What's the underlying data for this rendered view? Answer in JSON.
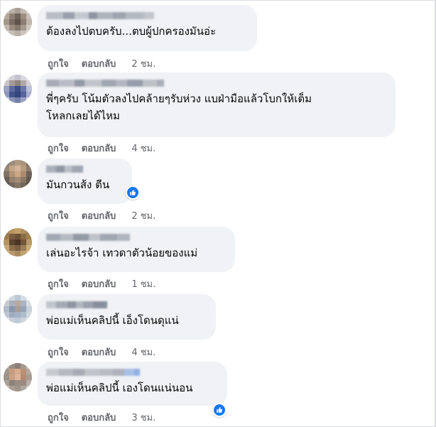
{
  "colors": {
    "bubble_bg": "#f0f2f5",
    "action_text": "#65676b",
    "like_blue": "#1877f2"
  },
  "comments": [
    {
      "text_lines": [
        "ต้องลงไปตบครับ...ตบผู้ปกครองมันอ่ะ"
      ],
      "like_label": "ถูกใจ",
      "reply_label": "ตอบกลับ",
      "time": "2 ชม.",
      "has_like_reaction": false
    },
    {
      "text_lines": [
        "พี่ๆครับ โน้มตัวลงไปคล้ายๆรับห่วง แบฝ่ามือแล้วโบกให้เต็ม",
        "โหลกเลยได้ไหม"
      ],
      "like_label": "ถูกใจ",
      "reply_label": "ตอบกลับ",
      "time": "4 ชม.",
      "has_like_reaction": false
    },
    {
      "text_lines": [
        "มันกวนส้ง ตีน"
      ],
      "like_label": "ถูกใจ",
      "reply_label": "ตอบกลับ",
      "time": "2 ชม.",
      "has_like_reaction": true,
      "reaction_icon": "like-thumb-icon"
    },
    {
      "text_lines": [
        "เล่นอะไรจ้า เทวดาตัวน้อยของแม่"
      ],
      "like_label": "ถูกใจ",
      "reply_label": "ตอบกลับ",
      "time": "1 ชม.",
      "has_like_reaction": false
    },
    {
      "text_lines": [
        "พ่อแม่เห็นคลิปนี้ เอ็งโดนดุแน่"
      ],
      "like_label": "ถูกใจ",
      "reply_label": "ตอบกลับ",
      "time": "4 ชม.",
      "has_like_reaction": false
    },
    {
      "text_lines": [
        "พ่อแม่เห็นคลิปนี้ เองโดนแน่นอน"
      ],
      "like_label": "ถูกใจ",
      "reply_label": "ตอบกลับ",
      "time": "3 ชม.",
      "has_like_reaction": true,
      "reaction_icon": "like-thumb-icon"
    }
  ]
}
